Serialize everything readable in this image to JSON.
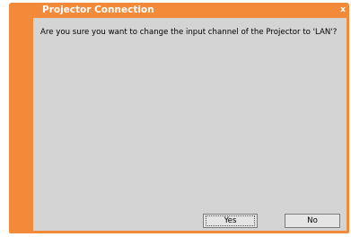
{
  "dialog": {
    "title": "Projector Connection",
    "close_label": "x",
    "message": "Are you sure you want to change the input channel of the Projector to 'LAN'?",
    "buttons": {
      "yes_label": "Yes",
      "no_label": "No"
    }
  },
  "colors": {
    "accent": "#f28a3a",
    "client_background": "#d4d4d4",
    "button_background": "#e4e4e4"
  }
}
